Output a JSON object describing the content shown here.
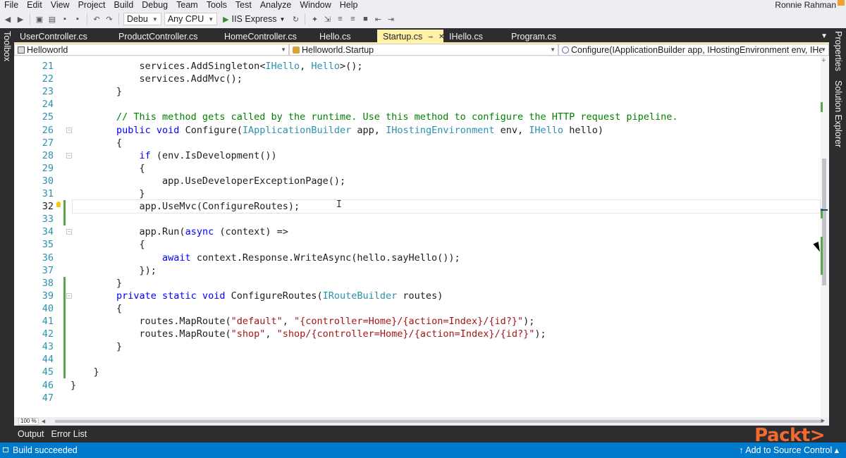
{
  "menu": {
    "items": [
      "File",
      "Edit",
      "View",
      "Project",
      "Build",
      "Debug",
      "Team",
      "Tools",
      "Test",
      "Analyze",
      "Window",
      "Help"
    ],
    "user": "Ronnie Rahman"
  },
  "toolbar": {
    "config": "Debu",
    "platform": "Any CPU",
    "run_target": "IIS Express"
  },
  "side": {
    "toolbox": "Toolbox",
    "solution_explorer": "Solution Explorer",
    "properties": "Properties"
  },
  "tabs": [
    {
      "label": "UserController.cs",
      "active": false
    },
    {
      "label": "ProductController.cs",
      "active": false
    },
    {
      "label": "HomeController.cs",
      "active": false
    },
    {
      "label": "Hello.cs",
      "active": false
    },
    {
      "label": "Startup.cs",
      "active": true
    },
    {
      "label": "IHello.cs",
      "active": false
    },
    {
      "label": "Program.cs",
      "active": false
    }
  ],
  "nav": {
    "project": "Helloworld",
    "type": "Helloworld.Startup",
    "member": "Configure(IApplicationBuilder app, IHostingEnvironment env, IHello l"
  },
  "editor": {
    "current_line": 32,
    "lines": [
      {
        "n": 21,
        "parts": [
          [
            "",
            "            services.AddSingleton<"
          ],
          [
            "ty",
            "IHello"
          ],
          [
            "",
            ", "
          ],
          [
            "ty",
            "Hello"
          ],
          [
            "",
            ">();"
          ]
        ]
      },
      {
        "n": 22,
        "parts": [
          [
            "",
            "            services.AddMvc();"
          ]
        ]
      },
      {
        "n": 23,
        "parts": [
          [
            "",
            "        }"
          ]
        ]
      },
      {
        "n": 24,
        "parts": [
          [
            "",
            ""
          ]
        ]
      },
      {
        "n": 25,
        "parts": [
          [
            "cm",
            "        // This method gets called by the runtime. Use this method to configure the HTTP request pipeline."
          ]
        ]
      },
      {
        "n": 26,
        "parts": [
          [
            "kw",
            "        public void "
          ],
          [
            "",
            "Configure("
          ],
          [
            "ty",
            "IApplicationBuilder"
          ],
          [
            "",
            " app, "
          ],
          [
            "ty",
            "IHostingEnvironment"
          ],
          [
            "",
            " env, "
          ],
          [
            "ty",
            "IHello"
          ],
          [
            "",
            " hello)"
          ]
        ]
      },
      {
        "n": 27,
        "parts": [
          [
            "",
            "        {"
          ]
        ]
      },
      {
        "n": 28,
        "parts": [
          [
            "kw",
            "            if "
          ],
          [
            "",
            "(env.IsDevelopment())"
          ]
        ]
      },
      {
        "n": 29,
        "parts": [
          [
            "",
            "            {"
          ]
        ]
      },
      {
        "n": 30,
        "parts": [
          [
            "",
            "                app.UseDeveloperExceptionPage();"
          ]
        ]
      },
      {
        "n": 31,
        "parts": [
          [
            "",
            "            }"
          ]
        ]
      },
      {
        "n": 32,
        "parts": [
          [
            "",
            "            app.UseMvc(ConfigureRoutes);"
          ]
        ]
      },
      {
        "n": 33,
        "parts": [
          [
            "",
            ""
          ]
        ]
      },
      {
        "n": 34,
        "parts": [
          [
            "",
            "            app.Run("
          ],
          [
            "kw",
            "async"
          ],
          [
            "",
            " (context) =>"
          ]
        ]
      },
      {
        "n": 35,
        "parts": [
          [
            "",
            "            {"
          ]
        ]
      },
      {
        "n": 36,
        "parts": [
          [
            "kw",
            "                await "
          ],
          [
            "",
            "context.Response.WriteAsync(hello.sayHello());"
          ]
        ]
      },
      {
        "n": 37,
        "parts": [
          [
            "",
            "            });"
          ]
        ]
      },
      {
        "n": 38,
        "parts": [
          [
            "",
            "        }"
          ]
        ]
      },
      {
        "n": 39,
        "parts": [
          [
            "kw",
            "        private static void "
          ],
          [
            "",
            "ConfigureRoutes("
          ],
          [
            "ty",
            "IRouteBuilder"
          ],
          [
            "",
            " routes)"
          ]
        ]
      },
      {
        "n": 40,
        "parts": [
          [
            "",
            "        {"
          ]
        ]
      },
      {
        "n": 41,
        "parts": [
          [
            "",
            "            routes.MapRoute("
          ],
          [
            "st",
            "\"default\""
          ],
          [
            "",
            ", "
          ],
          [
            "st",
            "\"{controller=Home}/{action=Index}/{id?}\""
          ],
          [
            "",
            ");"
          ]
        ]
      },
      {
        "n": 42,
        "parts": [
          [
            "",
            "            routes.MapRoute("
          ],
          [
            "st",
            "\"shop\""
          ],
          [
            "",
            ", "
          ],
          [
            "st",
            "\"shop/{controller=Home}/{action=Index}/{id?}\""
          ],
          [
            "",
            ");"
          ]
        ]
      },
      {
        "n": 43,
        "parts": [
          [
            "",
            "        }"
          ]
        ]
      },
      {
        "n": 44,
        "parts": [
          [
            "",
            ""
          ]
        ]
      },
      {
        "n": 45,
        "parts": [
          [
            "",
            "    }"
          ]
        ]
      },
      {
        "n": 46,
        "parts": [
          [
            "",
            "}"
          ]
        ]
      },
      {
        "n": 47,
        "parts": [
          [
            "",
            ""
          ]
        ]
      }
    ]
  },
  "zoom": "100 %",
  "output_tabs": [
    "Output",
    "Error List"
  ],
  "status": {
    "message": "Build succeeded",
    "source_control": "↑ Add to Source Control ▴"
  },
  "logo": "Packt>",
  "colors": {
    "status_bar": "#007acc",
    "active_tab": "#fff1a8",
    "keyword": "#0000ff",
    "type": "#2b91af",
    "comment": "#008000",
    "string": "#a31515",
    "change_marker": "#57a64a"
  }
}
